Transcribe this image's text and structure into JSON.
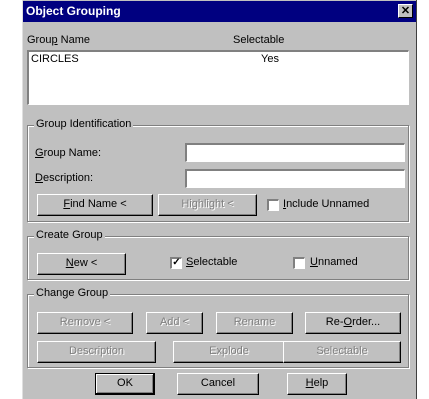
{
  "dialog": {
    "title": "Object Grouping",
    "close_glyph": "✕"
  },
  "list": {
    "columns": [
      "Group Name",
      "Selectable"
    ],
    "rows": [
      {
        "name": "CIRCLES",
        "selectable": "Yes"
      }
    ]
  },
  "identification": {
    "legend": "Group Identification",
    "group_name_label": "Group Name:",
    "group_name_value": "",
    "description_label": "Description:",
    "description_value": "",
    "find_name": "Find Name <",
    "highlight": "Highlight <",
    "include_unnamed": "Include Unnamed",
    "include_unnamed_checked": false
  },
  "create": {
    "legend": "Create Group",
    "new_button": "New <",
    "selectable": "Selectable",
    "selectable_checked": true,
    "unnamed": "Unnamed",
    "unnamed_checked": false
  },
  "change": {
    "legend": "Change Group",
    "remove": "Remove <",
    "add": "Add <",
    "rename": "Rename",
    "reorder": "Re-Order...",
    "description": "Description",
    "explode": "Explode",
    "selectable": "Selectable"
  },
  "footer": {
    "ok": "OK",
    "cancel": "Cancel",
    "help": "Help"
  }
}
